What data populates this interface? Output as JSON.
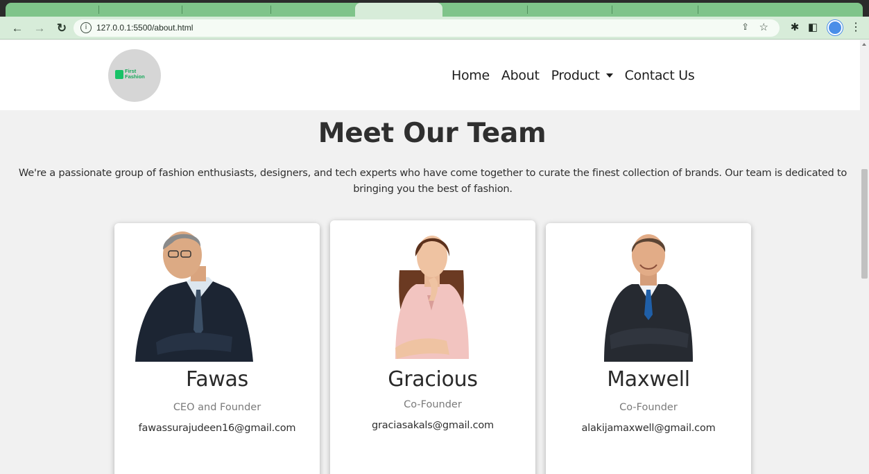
{
  "browser": {
    "url": "127.0.0.1:5500/about.html",
    "icons": [
      "back-icon",
      "forward-icon",
      "reload-icon",
      "info-icon",
      "share-icon",
      "star-icon",
      "extensions-icon",
      "sidepanel-icon",
      "profile-icon",
      "menu-icon"
    ]
  },
  "site": {
    "logo_text_line1": "First",
    "logo_text_line2": "Fashion",
    "nav": {
      "home": "Home",
      "about": "About",
      "product": "Product",
      "contact": "Contact Us"
    }
  },
  "team": {
    "title": "Meet Our Team",
    "intro_line1": "We're a passionate group of fashion enthusiasts, designers, and tech experts who have come together to curate the finest collection of brands. Our team is dedicated to",
    "intro_line2": "bringing you the best of fashion.",
    "members": [
      {
        "name": "Fawas",
        "role": "CEO and Founder",
        "email": "fawassurajudeen16@gmail.com"
      },
      {
        "name": "Gracious",
        "role": "Co-Founder",
        "email": "graciasakals@gmail.com"
      },
      {
        "name": "Maxwell",
        "role": "Co-Founder",
        "email": "alakijamaxwell@gmail.com"
      }
    ]
  },
  "colors": {
    "page_bg": "#f1f1f1",
    "header_bg": "#ffffff",
    "logo_green": "#18c267",
    "chrome_green": "#d7ecd9"
  }
}
